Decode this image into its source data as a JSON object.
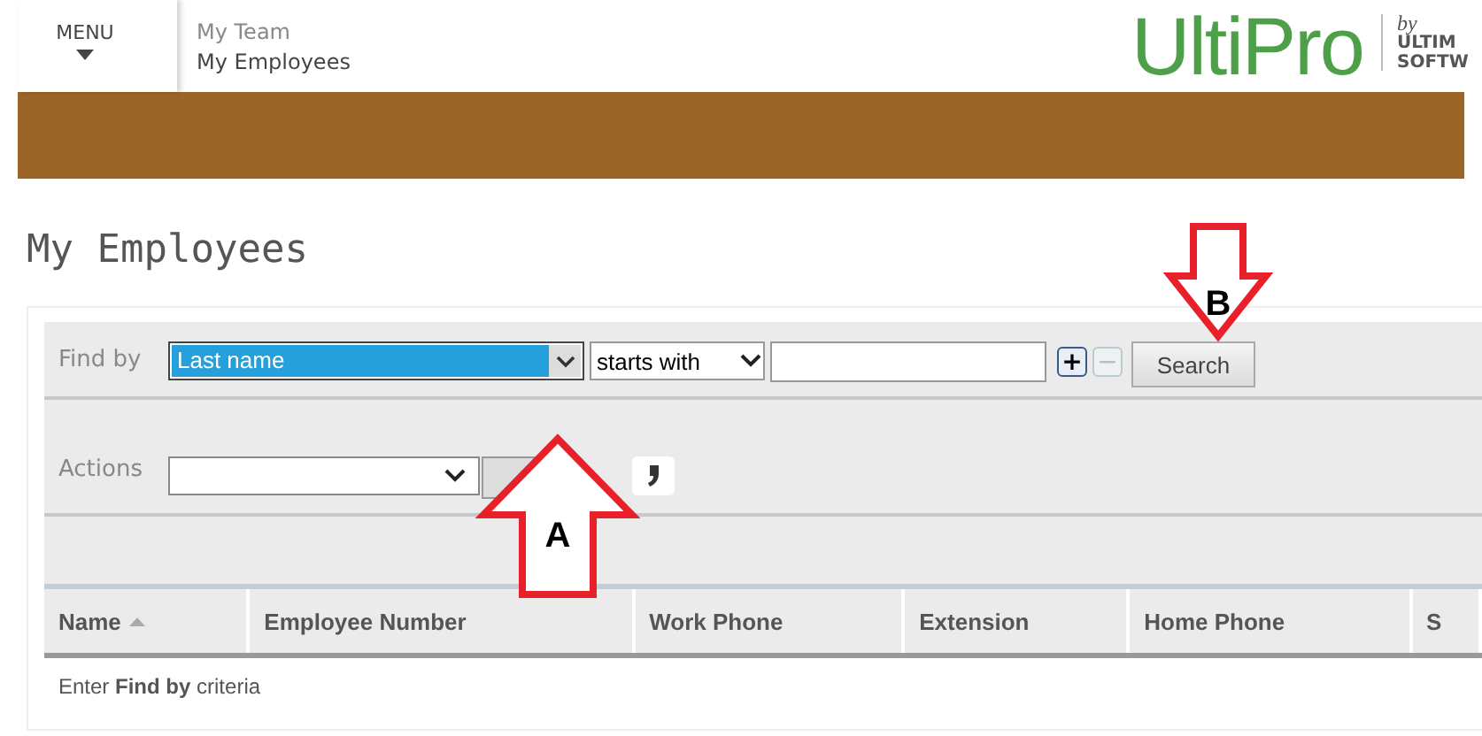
{
  "header": {
    "menu_label": "MENU",
    "breadcrumb": [
      "My Team",
      "My Employees"
    ],
    "logo": "UltiPro",
    "logo_by": "by",
    "logo_company": [
      "ULTIM",
      "SOFTW"
    ]
  },
  "page_title": "My Employees",
  "find_by": {
    "label": "Find by",
    "field": "Last name",
    "field_highlighted": true,
    "operator": "starts with",
    "add_button": {
      "label": "+",
      "disabled": false
    },
    "remove_button": {
      "label": "−",
      "disabled": true
    },
    "search_button": "Search"
  },
  "actions": {
    "label": "Actions"
  },
  "table": {
    "columns": [
      {
        "label": "Name",
        "sorted": true
      },
      {
        "label": "Employee Number",
        "sorted": false
      },
      {
        "label": "Work Phone",
        "sorted": false
      },
      {
        "label": "Extension",
        "sorted": false
      },
      {
        "label": "Home Phone",
        "sorted": false
      },
      {
        "label": "S",
        "sorted": false
      }
    ],
    "empty_message": "Enter **Find by** criteria"
  },
  "callouts": [
    {
      "letter": "A",
      "kind": "up"
    },
    {
      "letter": "B",
      "kind": "down"
    }
  ]
}
